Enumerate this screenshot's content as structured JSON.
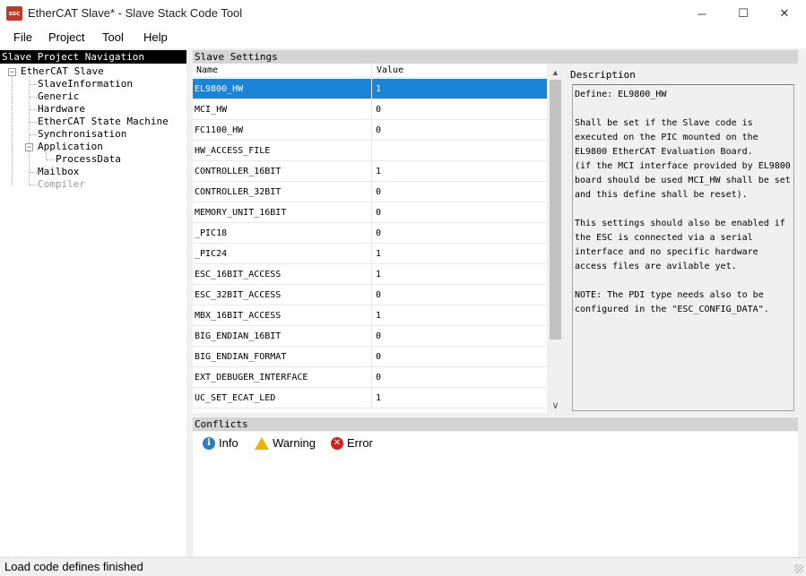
{
  "window": {
    "icon_text": "ssc",
    "title": "EtherCAT Slave* - Slave Stack Code Tool",
    "minimize_glyph": "─",
    "maximize_glyph": "☐",
    "close_glyph": "✕"
  },
  "menu": [
    "File",
    "Project",
    "Tool",
    "Help"
  ],
  "nav": {
    "header": "Slave Project Navigation",
    "root": "EtherCAT Slave",
    "items": [
      "SlaveInformation",
      "Generic",
      "Hardware",
      "EtherCAT State Machine",
      "Synchronisation",
      "Application",
      "Mailbox",
      "Compiler"
    ],
    "child": "ProcessData",
    "expander_minus": "−"
  },
  "settings": {
    "header": "Slave Settings",
    "col_name": "Name",
    "col_value": "Value",
    "rows": [
      {
        "name": "EL9800_HW",
        "value": "1"
      },
      {
        "name": "MCI_HW",
        "value": "0"
      },
      {
        "name": "FC1100_HW",
        "value": "0"
      },
      {
        "name": "HW_ACCESS_FILE",
        "value": ""
      },
      {
        "name": "CONTROLLER_16BIT",
        "value": "1"
      },
      {
        "name": "CONTROLLER_32BIT",
        "value": "0"
      },
      {
        "name": "MEMORY_UNIT_16BIT",
        "value": "0"
      },
      {
        "name": "_PIC18",
        "value": "0"
      },
      {
        "name": "_PIC24",
        "value": "1"
      },
      {
        "name": "ESC_16BIT_ACCESS",
        "value": "1"
      },
      {
        "name": "ESC_32BIT_ACCESS",
        "value": "0"
      },
      {
        "name": "MBX_16BIT_ACCESS",
        "value": "1"
      },
      {
        "name": "BIG_ENDIAN_16BIT",
        "value": "0"
      },
      {
        "name": "BIG_ENDIAN_FORMAT",
        "value": "0"
      },
      {
        "name": "EXT_DEBUGER_INTERFACE",
        "value": "0"
      },
      {
        "name": "UC_SET_ECAT_LED",
        "value": "1"
      }
    ],
    "scroll_up": "▲",
    "scroll_down": "∨"
  },
  "description": {
    "label": "Description",
    "text": "Define: EL9800_HW\n\nShall be set if the Slave code is\nexecuted on the PIC mounted on the\nEL9800 EtherCAT Evaluation Board.\n(if the MCI interface provided by EL9800\nboard should be used MCI_HW shall be set\nand this define shall be reset).\n\nThis settings should also be enabled if\nthe ESC is connected via a serial\ninterface and no specific hardware\naccess files are avilable yet.\n\nNOTE: The PDI type needs also to be\nconfigured in the \"ESC_CONFIG_DATA\"."
  },
  "conflicts": {
    "header": "Conflicts",
    "info_label": "Info",
    "warning_label": "Warning",
    "error_label": "Error",
    "info_glyph": "i",
    "error_glyph": "✕"
  },
  "status": {
    "text": "Load code defines finished"
  }
}
